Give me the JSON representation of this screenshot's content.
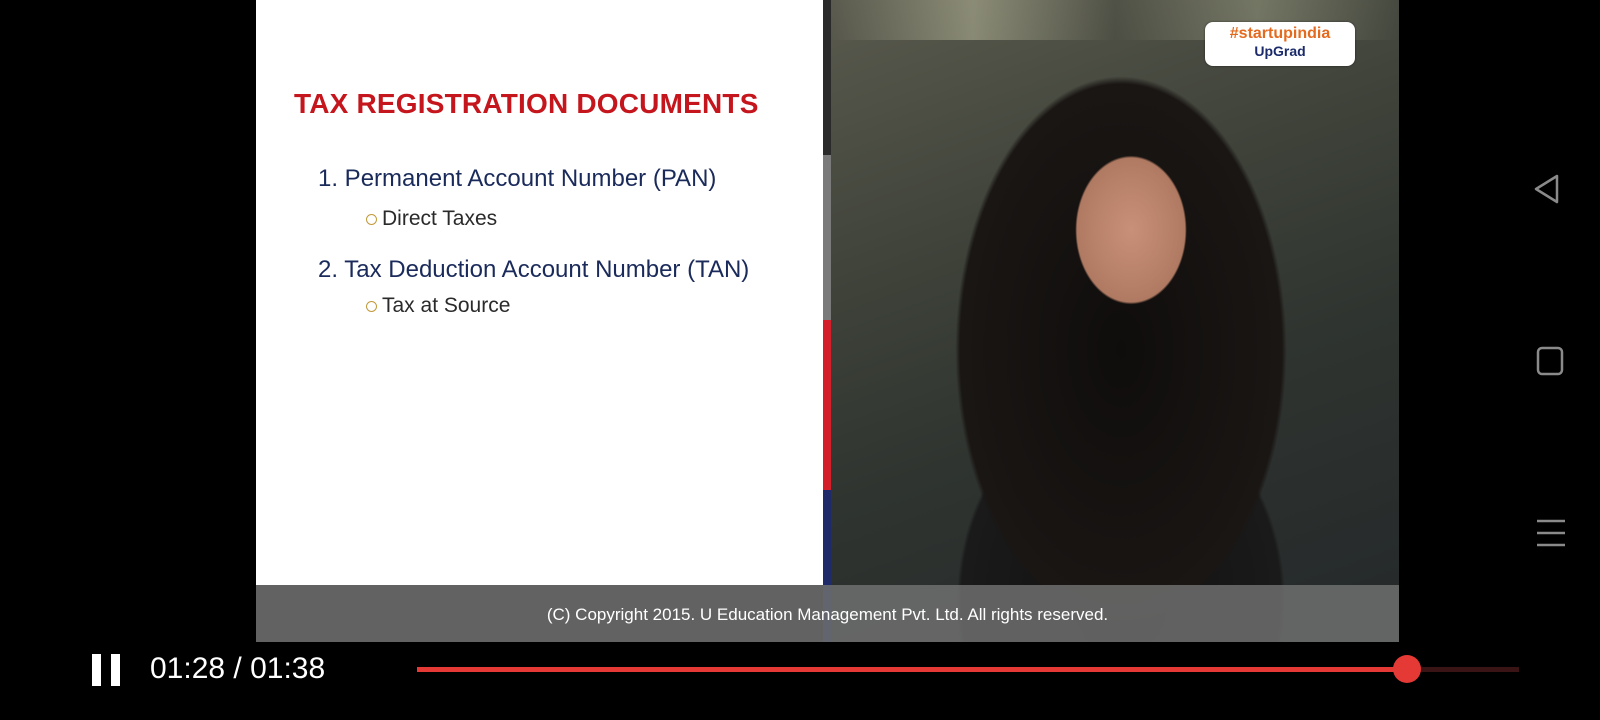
{
  "slide": {
    "title": "TAX REGISTRATION DOCUMENTS",
    "items": [
      {
        "label": "1. Permanent Account Number (PAN)",
        "sub": "Direct Taxes"
      },
      {
        "label": "2. Tax Deduction Account Number (TAN)",
        "sub": "Tax at Source"
      }
    ]
  },
  "brand": {
    "tag": "#startupindia",
    "name": "UpGrad"
  },
  "copyright": "(C) Copyright 2015. U Education Management Pvt. Ltd. All rights reserved.",
  "player": {
    "time": "01:28 / 01:38",
    "progress": 0.898,
    "colors": {
      "accent": "#e53935"
    }
  },
  "nav": {
    "back": "back-icon",
    "home": "home-icon",
    "menu": "menu-icon"
  }
}
